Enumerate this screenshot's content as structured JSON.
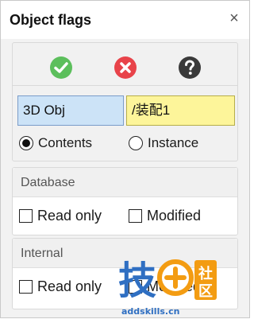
{
  "window": {
    "title": "Object flags",
    "close_label": "×"
  },
  "toolbar": {
    "ok_icon": "check-circle-icon",
    "cancel_icon": "x-circle-icon",
    "help_icon": "question-circle-icon",
    "colors": {
      "ok": "#5cbf5c",
      "cancel": "#e8434a",
      "help": "#3a3a3a"
    }
  },
  "fields": {
    "name_value": "3D Obj",
    "path_value": "/装配1"
  },
  "mode": {
    "options": [
      {
        "label": "Contents",
        "selected": true
      },
      {
        "label": "Instance",
        "selected": false
      }
    ]
  },
  "database": {
    "heading": "Database",
    "checks": [
      {
        "label": "Read only",
        "checked": false
      },
      {
        "label": "Modified",
        "checked": false
      }
    ]
  },
  "internal": {
    "heading": "Internal",
    "checks": [
      {
        "label": "Read only",
        "checked": false
      },
      {
        "label": "Modified",
        "checked": false
      }
    ]
  },
  "watermark": {
    "brand": "技",
    "side_text": "社区",
    "site": "addskills.cn"
  }
}
